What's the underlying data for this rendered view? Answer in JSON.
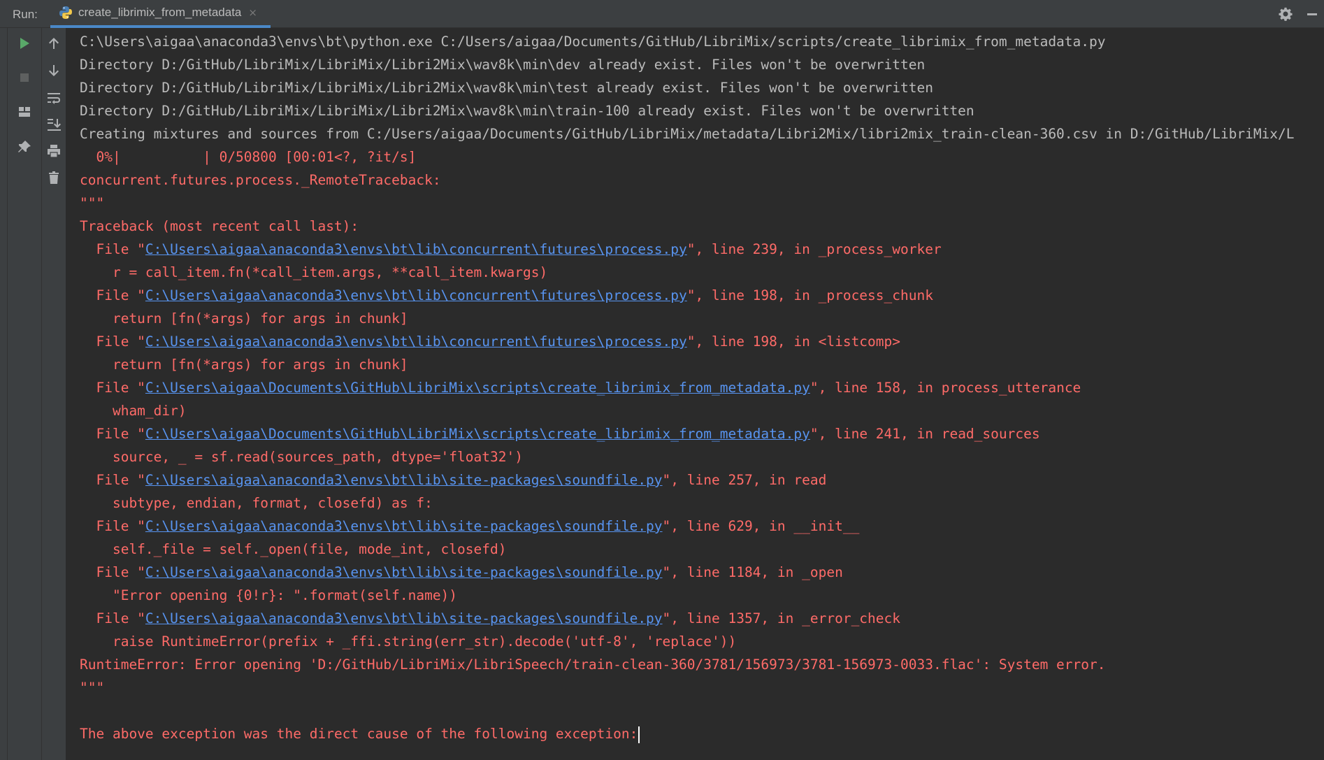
{
  "run": {
    "label": "Run:",
    "tab_title": "create_librimix_from_metadata",
    "tab_close": "×"
  },
  "colors": {
    "background": "#2b2b2b",
    "toolbar": "#3c3f41",
    "normal_text": "#bbbbbb",
    "error_text": "#ff6b68",
    "link": "#5894f0",
    "run_green": "#59a869"
  },
  "icons": {
    "run": "run-icon",
    "stop": "stop-icon",
    "layout": "layout-icon",
    "pin": "pin-icon",
    "up": "arrow-up-icon",
    "down": "arrow-down-icon",
    "wrap": "soft-wrap-icon",
    "scroll_end": "scroll-to-end-icon",
    "print": "print-icon",
    "trash": "trash-icon",
    "settings": "gear-icon",
    "minimize": "minimize-icon"
  },
  "console": {
    "l1": "C:\\Users\\aigaa\\anaconda3\\envs\\bt\\python.exe C:/Users/aigaa/Documents/GitHub/LibriMix/scripts/create_librimix_from_metadata.py",
    "l2": "Directory D:/GitHub/LibriMix/LibriMix/Libri2Mix\\wav8k\\min\\dev already exist. Files won't be overwritten",
    "l3": "Directory D:/GitHub/LibriMix/LibriMix/Libri2Mix\\wav8k\\min\\test already exist. Files won't be overwritten",
    "l4": "Directory D:/GitHub/LibriMix/LibriMix/Libri2Mix\\wav8k\\min\\train-100 already exist. Files won't be overwritten",
    "l5": "Creating mixtures and sources from C:/Users/aigaa/Documents/GitHub/LibriMix/metadata/Libri2Mix/libri2mix_train-clean-360.csv in D:/GitHub/LibriMix/L",
    "l6": "  0%|          | 0/50800 [00:01<?, ?it/s]",
    "l7": "concurrent.futures.process._RemoteTraceback:",
    "l8": "\"\"\"",
    "l9": "Traceback (most recent call last):",
    "file_prefix": "  File \"",
    "f1_path": "C:\\Users\\aigaa\\anaconda3\\envs\\bt\\lib\\concurrent\\futures\\process.py",
    "f1_rest": "\", line 239, in _process_worker",
    "c1": "    r = call_item.fn(*call_item.args, **call_item.kwargs)",
    "f2_path": "C:\\Users\\aigaa\\anaconda3\\envs\\bt\\lib\\concurrent\\futures\\process.py",
    "f2_rest": "\", line 198, in _process_chunk",
    "c2": "    return [fn(*args) for args in chunk]",
    "f3_path": "C:\\Users\\aigaa\\anaconda3\\envs\\bt\\lib\\concurrent\\futures\\process.py",
    "f3_rest": "\", line 198, in <listcomp>",
    "c3": "    return [fn(*args) for args in chunk]",
    "f4_path": "C:\\Users\\aigaa\\Documents\\GitHub\\LibriMix\\scripts\\create_librimix_from_metadata.py",
    "f4_rest": "\", line 158, in process_utterance",
    "c4": "    wham_dir)",
    "f5_path": "C:\\Users\\aigaa\\Documents\\GitHub\\LibriMix\\scripts\\create_librimix_from_metadata.py",
    "f5_rest": "\", line 241, in read_sources",
    "c5": "    source, _ = sf.read(sources_path, dtype='float32')",
    "f6_path": "C:\\Users\\aigaa\\anaconda3\\envs\\bt\\lib\\site-packages\\soundfile.py",
    "f6_rest": "\", line 257, in read",
    "c6": "    subtype, endian, format, closefd) as f:",
    "f7_path": "C:\\Users\\aigaa\\anaconda3\\envs\\bt\\lib\\site-packages\\soundfile.py",
    "f7_rest": "\", line 629, in __init__",
    "c7": "    self._file = self._open(file, mode_int, closefd)",
    "f8_path": "C:\\Users\\aigaa\\anaconda3\\envs\\bt\\lib\\site-packages\\soundfile.py",
    "f8_rest": "\", line 1184, in _open",
    "c8": "    \"Error opening {0!r}: \".format(self.name))",
    "f9_path": "C:\\Users\\aigaa\\anaconda3\\envs\\bt\\lib\\site-packages\\soundfile.py",
    "f9_rest": "\", line 1357, in _error_check",
    "c9": "    raise RuntimeError(prefix + _ffi.string(err_str).decode('utf-8', 'replace'))",
    "l10": "RuntimeError: Error opening 'D:/GitHub/LibriMix/LibriSpeech/train-clean-360/3781/156973/3781-156973-0033.flac': System error.",
    "l11": "\"\"\"",
    "l12": "",
    "l13": "The above exception was the direct cause of the following exception:"
  }
}
